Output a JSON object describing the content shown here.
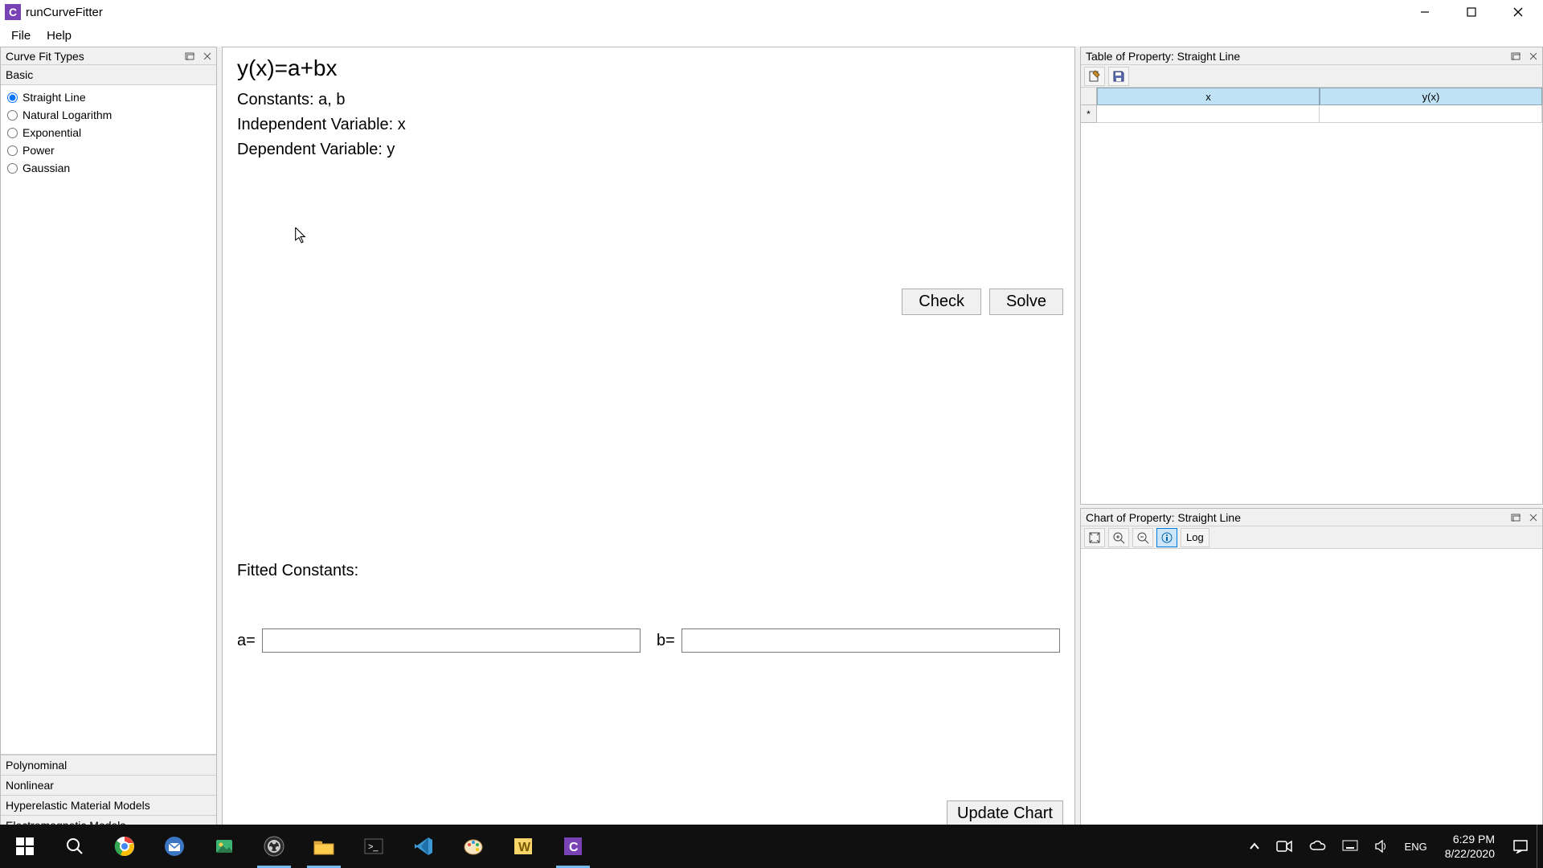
{
  "window": {
    "title": "runCurveFitter",
    "app_icon_letter": "C"
  },
  "menu": {
    "file": "File",
    "help": "Help"
  },
  "left_panel": {
    "title": "Curve Fit Types",
    "sections": {
      "basic": "Basic",
      "polynominal": "Polynominal",
      "nonlinear": "Nonlinear",
      "hyperelastic": "Hyperelastic Material Models",
      "electromagnetic": "Electromagnetic Models"
    },
    "basic_items": [
      {
        "label": "Straight Line",
        "checked": true
      },
      {
        "label": "Natural Logarithm",
        "checked": false
      },
      {
        "label": "Exponential",
        "checked": false
      },
      {
        "label": "Power",
        "checked": false
      },
      {
        "label": "Gaussian",
        "checked": false
      }
    ]
  },
  "center": {
    "equation": "y(x)=a+bx",
    "constants_line": "Constants: a, b",
    "indep_line": "Independent Variable: x",
    "dep_line": "Dependent Variable: y",
    "check_btn": "Check",
    "solve_btn": "Solve",
    "fitted_title": "Fitted Constants:",
    "a_label": "a=",
    "b_label": "b=",
    "a_value": "",
    "b_value": "",
    "update_chart_btn": "Update Chart"
  },
  "table_dock": {
    "title": "Table of Property: Straight Line",
    "col1": "x",
    "col2": "y(x)",
    "rowmarker": "*"
  },
  "chart_dock": {
    "title": "Chart of Property: Straight Line",
    "log_btn": "Log"
  },
  "taskbar": {
    "lang": "ENG",
    "time": "6:29 PM",
    "date": "8/22/2020"
  }
}
